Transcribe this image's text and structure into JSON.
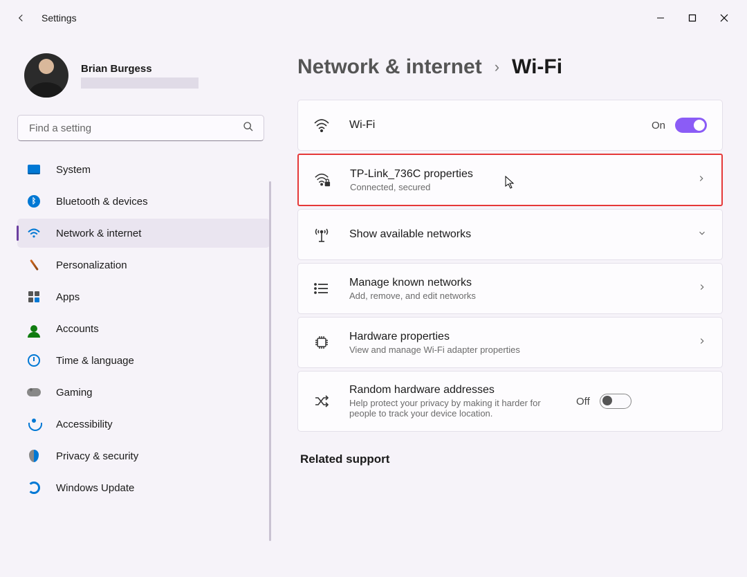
{
  "window": {
    "title": "Settings"
  },
  "profile": {
    "name": "Brian Burgess"
  },
  "search": {
    "placeholder": "Find a setting"
  },
  "nav": {
    "items": [
      {
        "label": "System"
      },
      {
        "label": "Bluetooth & devices"
      },
      {
        "label": "Network & internet"
      },
      {
        "label": "Personalization"
      },
      {
        "label": "Apps"
      },
      {
        "label": "Accounts"
      },
      {
        "label": "Time & language"
      },
      {
        "label": "Gaming"
      },
      {
        "label": "Accessibility"
      },
      {
        "label": "Privacy & security"
      },
      {
        "label": "Windows Update"
      }
    ],
    "selected_index": 2
  },
  "breadcrumb": {
    "parent": "Network & internet",
    "current": "Wi-Fi"
  },
  "cards": {
    "wifi": {
      "title": "Wi-Fi",
      "state_label": "On",
      "state": true
    },
    "network": {
      "title": "TP-Link_736C properties",
      "subtitle": "Connected, secured"
    },
    "available": {
      "title": "Show available networks"
    },
    "known": {
      "title": "Manage known networks",
      "subtitle": "Add, remove, and edit networks"
    },
    "hardware": {
      "title": "Hardware properties",
      "subtitle": "View and manage Wi-Fi adapter properties"
    },
    "random": {
      "title": "Random hardware addresses",
      "subtitle": "Help protect your privacy by making it harder for people to track your device location.",
      "state_label": "Off",
      "state": false
    }
  },
  "related": {
    "heading": "Related support"
  }
}
